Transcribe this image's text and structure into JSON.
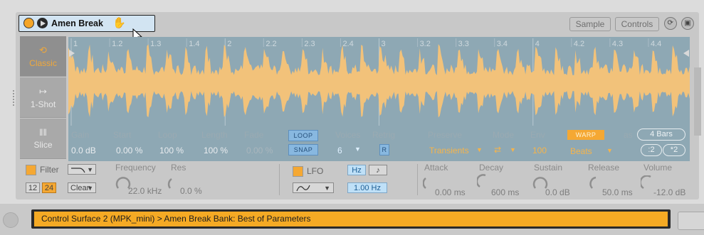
{
  "device": {
    "name": "Amen Break",
    "tabs": [
      "Sample",
      "Controls"
    ]
  },
  "modes": [
    {
      "label": "Classic",
      "icon": "loop-icon"
    },
    {
      "label": "1-Shot",
      "icon": "arrow-right-icon"
    },
    {
      "label": "Slice",
      "icon": "slice-icon"
    }
  ],
  "ruler": [
    "1",
    "1.2",
    "1.3",
    "1.4",
    "2",
    "2.2",
    "2.3",
    "2.4",
    "3",
    "3.2",
    "3.3",
    "3.4",
    "4",
    "4.2",
    "4.3",
    "4.4"
  ],
  "sample_params": {
    "gain_label": "Gain",
    "gain_value": "0.0 dB",
    "start_label": "Start",
    "start_value": "0.00 %",
    "loop_label": "Loop",
    "loop_value": "100 %",
    "length_label": "Length",
    "length_value": "100 %",
    "fade_label": "Fade",
    "fade_value": "0.00 %",
    "loop_button": "LOOP",
    "snap_button": "SNAP",
    "voices_label": "Voices",
    "voices_value": "6",
    "retrig_label": "Retrig",
    "retrig_value": "R",
    "preserve_label": "Preserve",
    "preserve_value": "Transients",
    "mode_label": "Mode",
    "mode_value": "⇄",
    "env_label": "Env",
    "env_value": "100",
    "warp_button": "WARP",
    "warp_mode": "Beats",
    "as_label": "as",
    "bars_value": "4 Bars",
    "half_button": ":2",
    "double_button": "*2"
  },
  "filter": {
    "label": "Filter",
    "slope_12": "12",
    "slope_24": "24",
    "type_value": "Clean",
    "frequency_label": "Frequency",
    "frequency_value": "22.0 kHz",
    "res_label": "Res",
    "res_value": "0.0 %"
  },
  "lfo": {
    "label": "LFO",
    "hz_button": "Hz",
    "note_button": "♪",
    "rate_value": "1.00 Hz"
  },
  "envelope": {
    "attack_label": "Attack",
    "attack_value": "0.00 ms",
    "decay_label": "Decay",
    "decay_value": "600 ms",
    "sustain_label": "Sustain",
    "sustain_value": "0.0 dB",
    "release_label": "Release",
    "release_value": "50.0 ms",
    "volume_label": "Volume",
    "volume_value": "-12.0 dB"
  },
  "status": {
    "text": "Control Surface 2 (MPK_mini) > Amen Break Bank: Best of Parameters"
  },
  "colors": {
    "accent_orange": "#f5a833",
    "waveform": "#f2c27a",
    "waveform_bg": "#8ea8b4",
    "title_bg": "#d2e4f2"
  }
}
